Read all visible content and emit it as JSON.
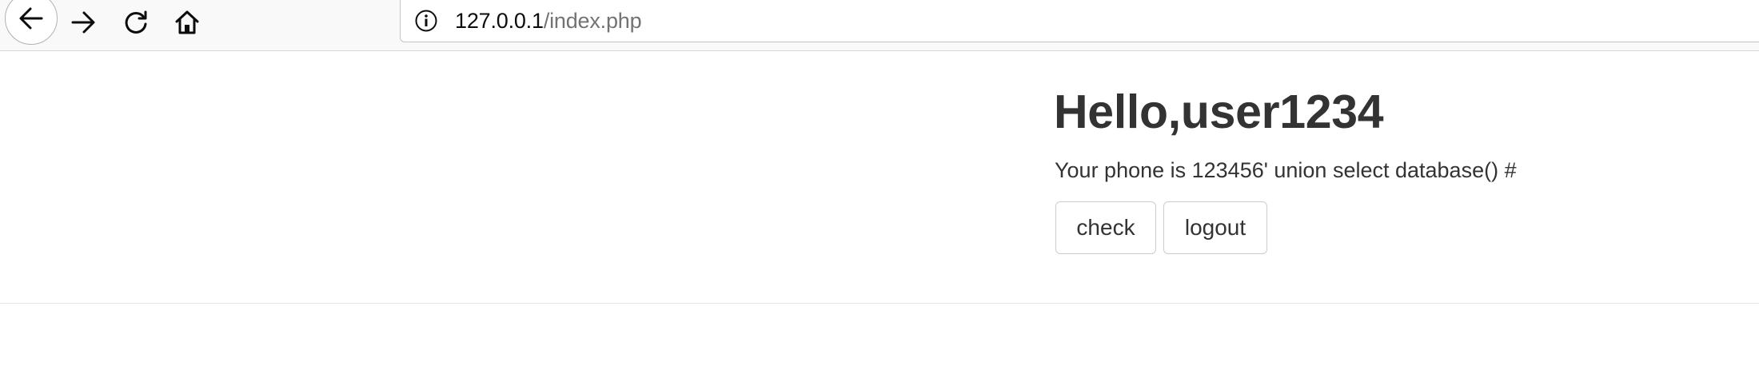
{
  "browser": {
    "url_host": "127.0.0.1",
    "url_path": "/index.php",
    "icons": {
      "back": "back-arrow-icon",
      "forward": "forward-arrow-icon",
      "reload": "reload-icon",
      "home": "home-icon",
      "info": "info-icon"
    }
  },
  "page": {
    "title": "Hello,user1234",
    "phone_text": "Your phone is 123456' union select database() #",
    "buttons": {
      "check": "check",
      "logout": "logout"
    }
  },
  "colors": {
    "text": "#333333",
    "url_host": "#0c0c0d",
    "url_path": "#737373",
    "toolbar_bg": "#f9f9fa",
    "button_border": "#cccccc"
  }
}
